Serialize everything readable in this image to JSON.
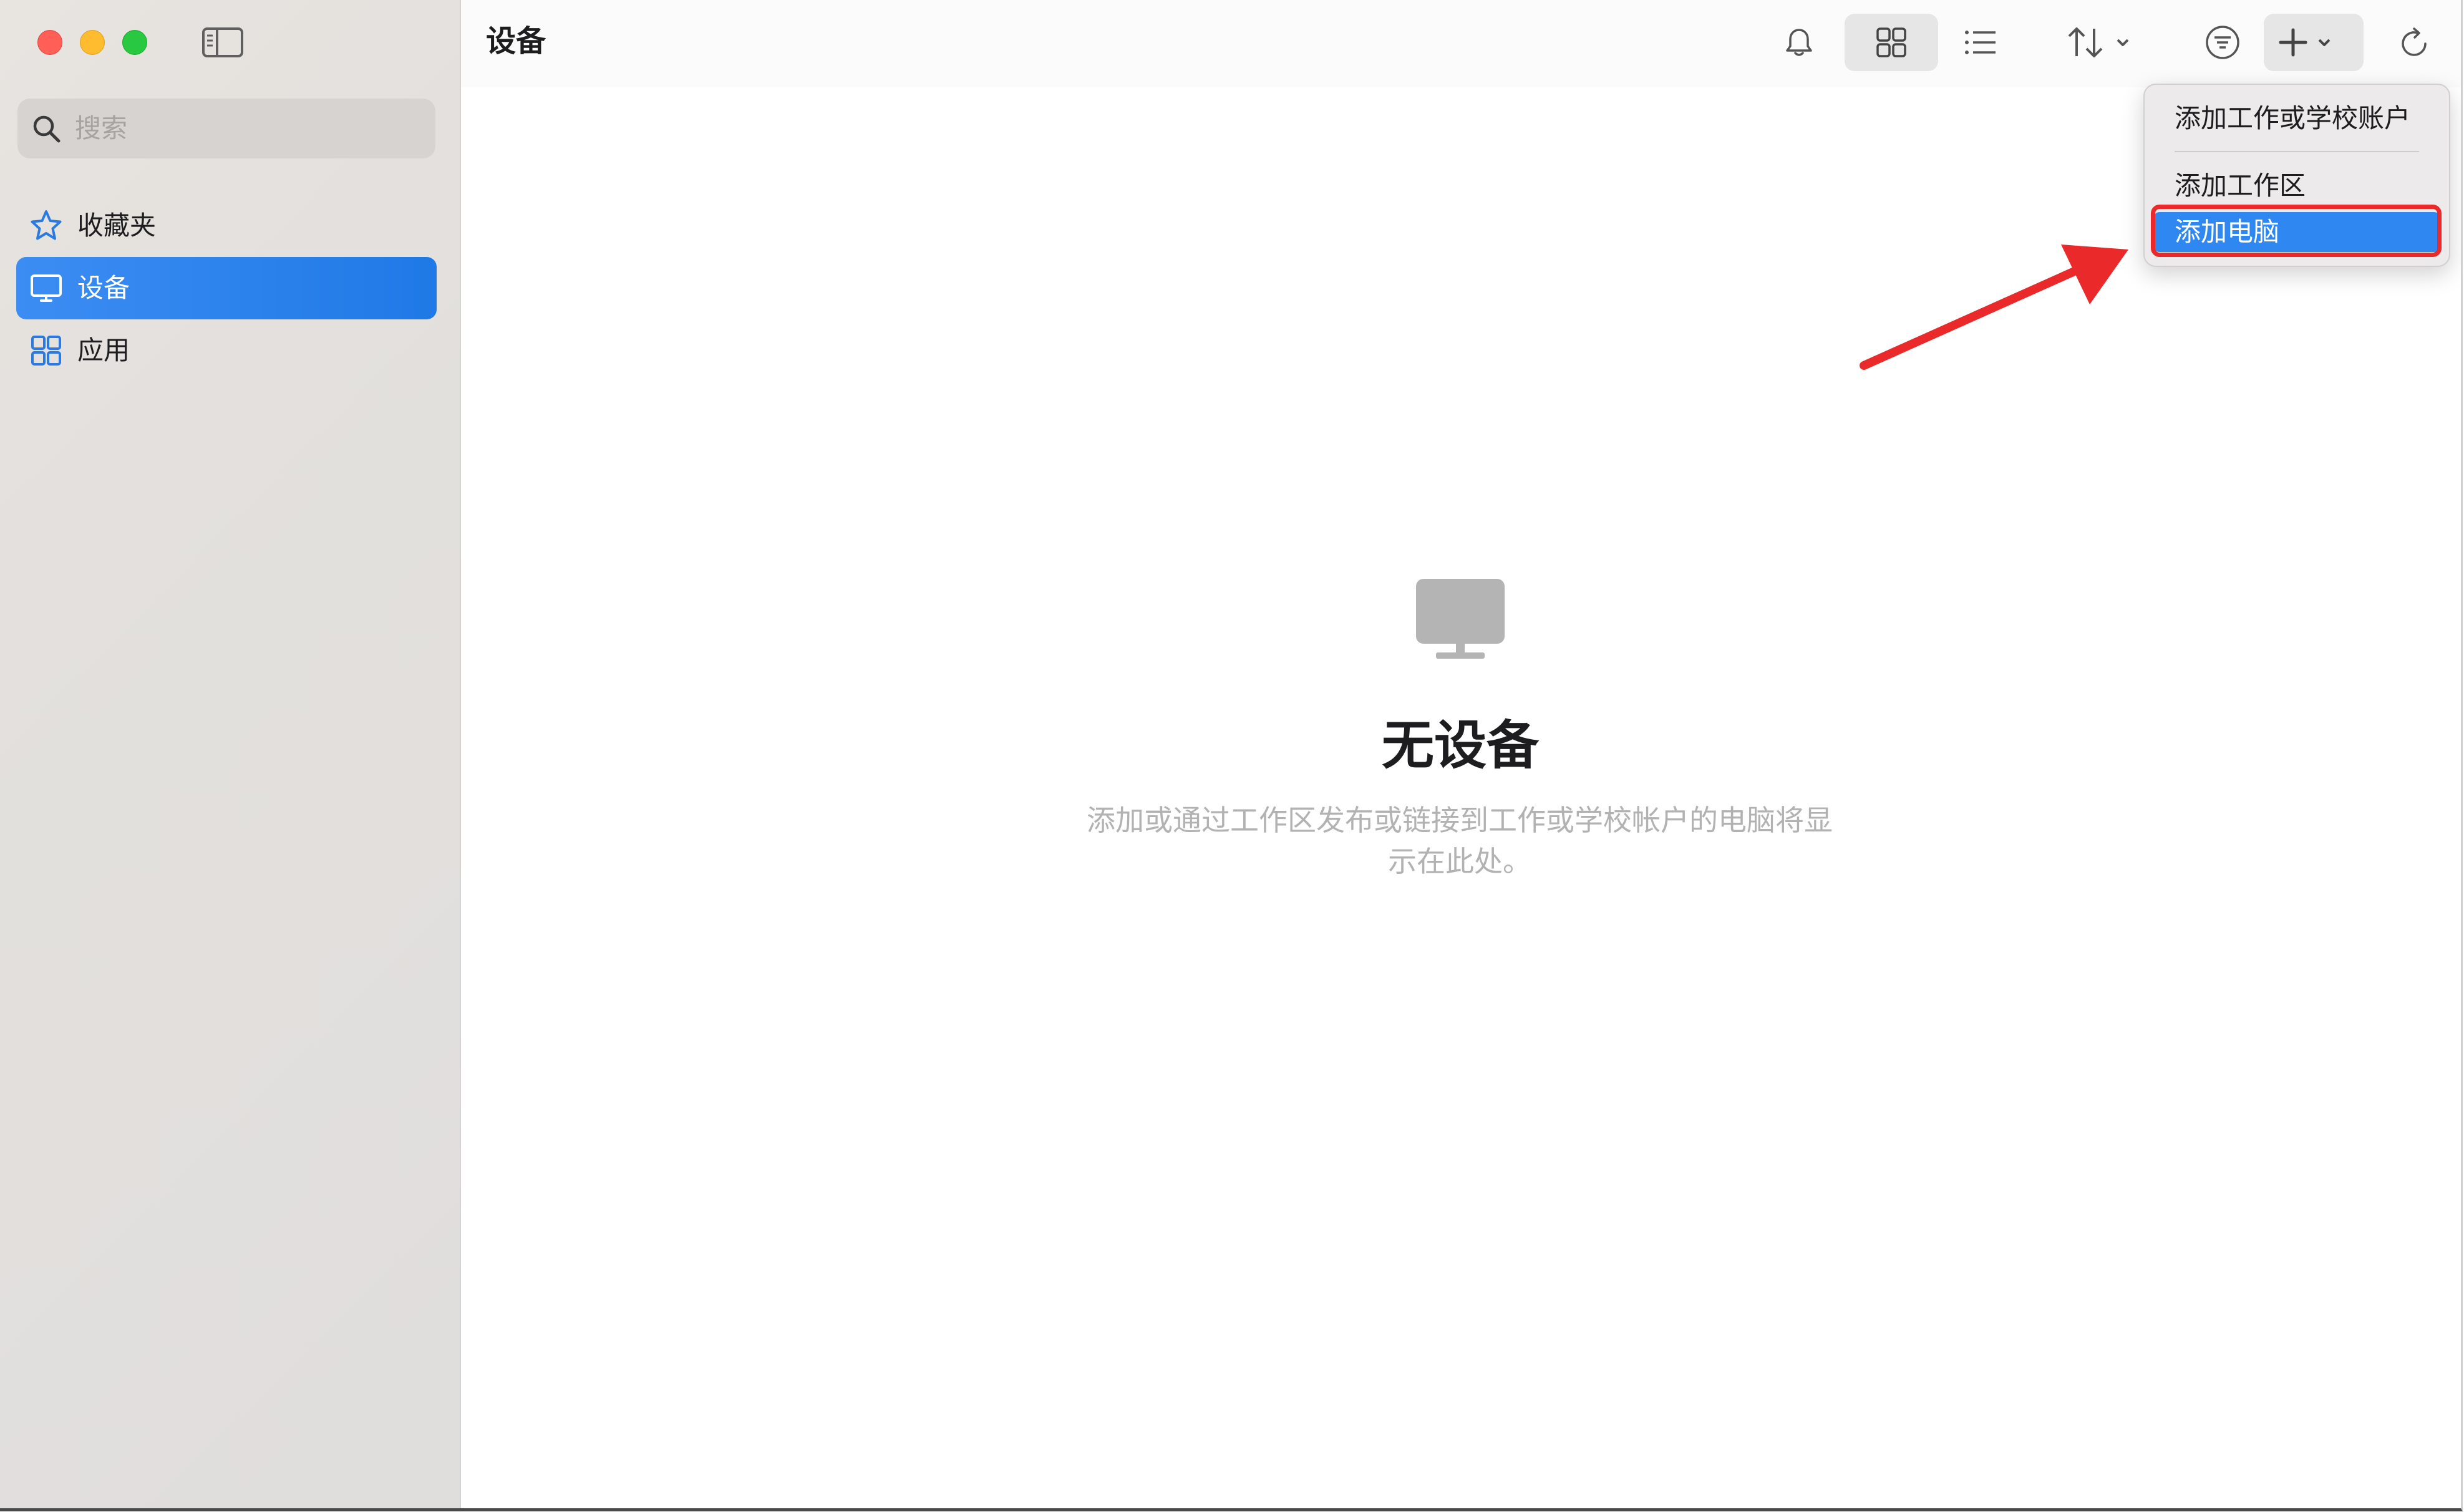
{
  "sidebar": {
    "search": {
      "placeholder": "搜索"
    },
    "items": [
      {
        "label": "收藏夹",
        "icon": "star-icon",
        "active": false
      },
      {
        "label": "设备",
        "icon": "monitor-icon",
        "active": true
      },
      {
        "label": "应用",
        "icon": "apps-icon",
        "active": false
      }
    ]
  },
  "toolbar": {
    "title": "设备",
    "buttons": [
      "bell-icon",
      "grid-view-icon",
      "list-view-icon",
      "sort-icon",
      "filter-icon",
      "plus-icon",
      "refresh-icon"
    ]
  },
  "empty_state": {
    "icon": "monitor-icon",
    "title": "无设备",
    "description_line1": "添加或通过工作区发布或链接到工作或学校帐户的电脑将显",
    "description_line2": "示在此处。"
  },
  "add_menu": {
    "items": [
      {
        "label": "添加工作或学校账户",
        "highlighted": false
      },
      {
        "label": "添加工作区",
        "highlighted": false
      },
      {
        "label": "添加电脑",
        "highlighted": true
      }
    ]
  },
  "colors": {
    "accent": "#2f87f1",
    "sidebar_active": "#1f79e6",
    "annotation": "#ea2a2a"
  }
}
